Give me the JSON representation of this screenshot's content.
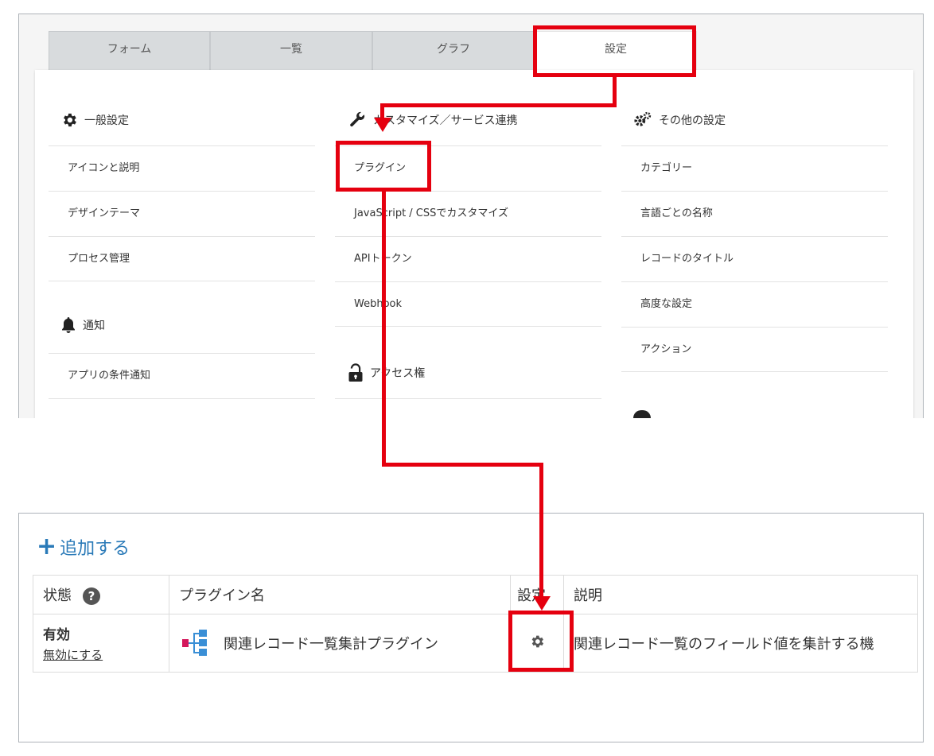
{
  "tabs": [
    "フォーム",
    "一覧",
    "グラフ",
    "設定"
  ],
  "general": {
    "heading": "一般設定",
    "items": [
      "アイコンと説明",
      "デザインテーマ",
      "プロセス管理"
    ]
  },
  "notify": {
    "heading": "通知",
    "items": [
      "アプリの条件通知"
    ]
  },
  "customize": {
    "heading": "カスタマイズ／サービス連携",
    "items": [
      "プラグイン",
      "JavaScript / CSSでカスタマイズ",
      "APIトークン",
      "Webhook"
    ]
  },
  "access": {
    "heading": "アクセス権"
  },
  "other": {
    "heading": "その他の設定",
    "items": [
      "カテゴリー",
      "言語ごとの名称",
      "レコードのタイトル",
      "高度な設定",
      "アクション"
    ]
  },
  "plugin_panel": {
    "add_label": "追加する",
    "headers": {
      "status": "状態",
      "name": "プラグイン名",
      "settings": "設定",
      "description": "説明"
    },
    "help_icon": "?",
    "row": {
      "status": "有効",
      "disable_link": "無効にする",
      "name": "関連レコード一覧集計プラグイン",
      "description": "関連レコード一覧のフィールド値を集計する機"
    }
  },
  "colors": {
    "annotation": "#e5000f",
    "link": "#2a7ab8",
    "icon": "#3a8fd6",
    "icon_accent": "#d4185c"
  }
}
